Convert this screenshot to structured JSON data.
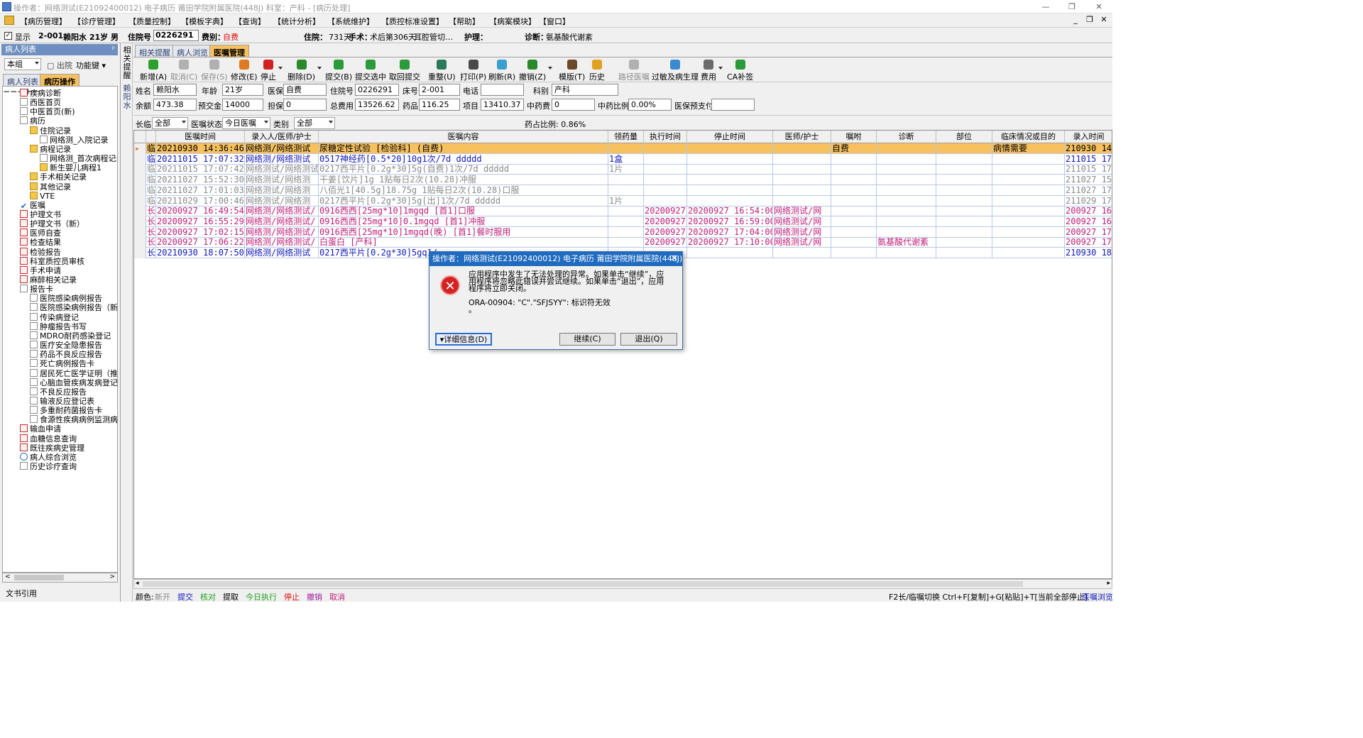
{
  "titlebar": {
    "text": "操作者：网络测试(E21092400012) 电子病历  莆田学院附属医院(448J)  科室：产科 - [病历处理]",
    "min": "—",
    "max": "❐",
    "close": "✕"
  },
  "menu": [
    "【病历管理】",
    "【诊疗管理】",
    "【质量控制】",
    "【模板字典】",
    "【查询】",
    "【统计分析】",
    "【系统维护】",
    "【质控标准设置】",
    "【帮助】",
    "【病案模块】",
    "【窗口】"
  ],
  "menu_right": {
    "min": "_",
    "restore": "❐",
    "close": "✕"
  },
  "patient_bar": {
    "show_label": "显示",
    "bed": "2-001",
    "name_age_sex": "赖阳水 21岁 男",
    "admission_label": "住院号",
    "admission_no": "0226291",
    "fee_label": "费别：",
    "fee_value": "自费",
    "hosp_label": "住院：",
    "hosp_days": "731天",
    "surgery_label": "手术：",
    "surgery_value": "术后第306天",
    "surgery_name": "耳腔管切…",
    "nursing_label": "护理：",
    "diagnosis_label": "诊断：",
    "diagnosis_value": "氨基酸代谢紊"
  },
  "left": {
    "header": "病人列表",
    "pin": "ᵖ",
    "group_value": "本组",
    "discharge_label": "出院",
    "func_label": "功能键",
    "tabs": [
      "病人列表",
      "病历操作"
    ],
    "tree": [
      {
        "label": "疾病诊断",
        "icon": "doc-red-icon"
      },
      {
        "label": "西医首页",
        "icon": "doc-icon"
      },
      {
        "label": "中医首页(新)",
        "icon": "doc-icon"
      },
      {
        "label": "病历",
        "icon": "doc-icon"
      },
      {
        "label": "住院记录",
        "icon": "folder-icon"
      },
      {
        "label": "网络测_入院记录",
        "icon": "doc-icon"
      },
      {
        "label": "病程记录",
        "icon": "folder-icon"
      },
      {
        "label": "网络测_首次病程记录",
        "icon": "doc-icon"
      },
      {
        "label": "新生婴儿病程1",
        "icon": "folder-icon"
      },
      {
        "label": "手术相关记录",
        "icon": "folder-icon"
      },
      {
        "label": "其他记录",
        "icon": "folder-icon"
      },
      {
        "label": "VTE",
        "icon": "folder-icon"
      },
      {
        "label": "医嘱",
        "icon": "check-icon"
      },
      {
        "label": "护理文书",
        "icon": "doc-red-icon"
      },
      {
        "label": "护理文书（新）",
        "icon": "doc-red-icon"
      },
      {
        "label": "医师自查",
        "icon": "doc-red-icon"
      },
      {
        "label": "检查结果",
        "icon": "doc-red-icon"
      },
      {
        "label": "检验报告",
        "icon": "doc-red-icon"
      },
      {
        "label": "科室质控员审核",
        "icon": "doc-red-icon"
      },
      {
        "label": "手术申请",
        "icon": "doc-red-icon"
      },
      {
        "label": "麻醉相关记录",
        "icon": "doc-red-icon"
      },
      {
        "label": "报告卡",
        "icon": "doc-icon"
      },
      {
        "label": "医院感染病例报告",
        "icon": "doc-icon"
      },
      {
        "label": "医院感染病例报告（新）",
        "icon": "doc-icon"
      },
      {
        "label": "传染病登记",
        "icon": "doc-icon"
      },
      {
        "label": "肿瘤报告书写",
        "icon": "doc-icon"
      },
      {
        "label": "MDRO耐药感染登记",
        "icon": "doc-icon"
      },
      {
        "label": "医疗安全隐患报告",
        "icon": "doc-icon"
      },
      {
        "label": "药品不良反应报告",
        "icon": "doc-icon"
      },
      {
        "label": "死亡病例报告卡",
        "icon": "doc-icon"
      },
      {
        "label": "居民死亡医学证明（推断",
        "icon": "doc-icon"
      },
      {
        "label": "心脑血管疾病发病登记报",
        "icon": "doc-icon"
      },
      {
        "label": "不良反应报告",
        "icon": "doc-icon"
      },
      {
        "label": "输液反应登记表",
        "icon": "doc-icon"
      },
      {
        "label": "多重耐药菌报告卡",
        "icon": "doc-icon"
      },
      {
        "label": "食源性疾病病例监测病例",
        "icon": "doc-icon"
      },
      {
        "label": "输血申请",
        "icon": "doc-red-icon"
      },
      {
        "label": "血糖信息查询",
        "icon": "doc-red-icon"
      },
      {
        "label": "既往疾病史管理",
        "icon": "doc-red-icon"
      },
      {
        "label": "病人综合浏览",
        "icon": "search-icon"
      },
      {
        "label": "历史诊疗查询",
        "icon": "doc-icon"
      }
    ],
    "footer": "文书引用"
  },
  "vstrip": {
    "top": "相关提醒",
    "bottom": "赖阳水"
  },
  "tabs": [
    "相关提醒",
    "病人浏览",
    "医嘱管理"
  ],
  "toolbar": [
    {
      "label": "新增(A)",
      "color": "#2aa02a"
    },
    {
      "label": "取消(C)",
      "color": "#b0b0b0",
      "disabled": true
    },
    {
      "label": "保存(S)",
      "color": "#b0b0b0",
      "disabled": true
    },
    {
      "label": "修改(E)",
      "color": "#e07a20"
    },
    {
      "label": "停止",
      "color": "#d02020"
    },
    {
      "label": "删除(D)",
      "color": "#2a8a2a"
    },
    {
      "label": "提交(B)",
      "color": "#2a9a3a"
    },
    {
      "label": "提交选中",
      "color": "#2a9a3a"
    },
    {
      "label": "取回提交",
      "color": "#2a9a3a"
    },
    {
      "label": "重整(U)",
      "color": "#2a7a5a"
    },
    {
      "label": "打印(P)",
      "color": "#4a4a4a"
    },
    {
      "label": "刷新(R)",
      "color": "#3aa0d0"
    },
    {
      "label": "撤销(Z)",
      "color": "#2a8a2a"
    },
    {
      "label": "模版(T)",
      "color": "#6a4a2a"
    },
    {
      "label": "历史",
      "color": "#e0a020"
    },
    {
      "label": "路径医嘱",
      "color": "#b0b0b0",
      "disabled": true
    },
    {
      "label": "过敏及病生理",
      "color": "#3a8ad0"
    },
    {
      "label": "费用",
      "color": "#6a6a6a"
    },
    {
      "label": "CA补签",
      "color": "#2a9a3a"
    }
  ],
  "info": {
    "name_label": "姓名",
    "name": "赖阳水",
    "age_label": "年龄",
    "age": "21岁",
    "insurance_label": "医保",
    "insurance": "自费",
    "inpatient_label": "住院号",
    "inpatient": "0226291",
    "bed_label": "床号",
    "bed": "2-001",
    "phone_label": "电话",
    "phone": "",
    "dept_label": "科别",
    "dept": "产科",
    "balance_label": "余额",
    "balance": "473.38",
    "deposit_label": "预交金",
    "deposit": "14000",
    "guarantee_label": "担保",
    "guarantee": "0",
    "total_label": "总费用",
    "total": "13526.62",
    "drug_label": "药品",
    "drug": "116.25",
    "item_label": "项目",
    "item": "13410.37",
    "tcm_label": "中药费",
    "tcm": "0",
    "tcm_ratio_label": "中药比例",
    "tcm_ratio": "0.00%",
    "prepay_label": "医保预支付",
    "prepay": ""
  },
  "filter": {
    "long_label": "长临",
    "long_value": "全部",
    "status_label": "医嘱状态",
    "status_value": "今日医嘱",
    "type_label": "类别",
    "type_value": "全部",
    "drug_ratio": "药占比例: 0.86%"
  },
  "grid": {
    "columns": [
      "",
      "",
      "医嘱时间",
      "录入人/医师/护士",
      "医嘱内容",
      "领药量",
      "执行时间",
      "停止时间",
      "医师/护士",
      "嘱咐",
      "诊断",
      "部位",
      "临床情况或目的",
      "录入时间"
    ],
    "rows": [
      {
        "style": "sel",
        "cells": [
          "▸",
          "临",
          "20210930 14:36:46",
          "网络测/网络测试",
          "尿糖定性试验  [检验科] (自费)",
          "",
          "",
          "",
          "",
          "自费",
          "",
          "",
          "病情需要",
          "210930 14:36:"
        ]
      },
      {
        "style": "blue",
        "cells": [
          "",
          "临",
          "20211015 17:07:32",
          "网络测/网络测试",
          "0517神经药[0.5*20]10g1次/7d ddddd",
          "1盒",
          "",
          "",
          "",
          "",
          "",
          "",
          "",
          "211015 17:07:"
        ]
      },
      {
        "style": "gray",
        "cells": [
          "",
          "临",
          "20211015 17:07:42",
          "网络测试/网络测试",
          "0217西平片[0.2g*30]5g(自费)1次/7d ddddd",
          "1片",
          "",
          "",
          "",
          "",
          "",
          "",
          "",
          "211015 17:08:"
        ]
      },
      {
        "style": "gray",
        "cells": [
          "",
          "临",
          "20211027 15:52:30",
          "网络测试/网络测",
          "干姜[饮片]1g  1贴每日2次(10.28)冲服",
          "",
          "",
          "",
          "",
          "",
          "",
          "",
          "",
          "211027 15:52:"
        ]
      },
      {
        "style": "gray",
        "cells": [
          "",
          "临",
          "20211027 17:01:03",
          "网络测试/网络测",
          "八佰光1[40.5g]18.75g 1贴每日2次(10.28)口服",
          "",
          "",
          "",
          "",
          "",
          "",
          "",
          "",
          "211027 17:14:"
        ]
      },
      {
        "style": "gray",
        "cells": [
          "",
          "临",
          "20211029 17:00:46",
          "网络测试/网络测",
          "0217西平片[0.2g*30]5g[出]1次/7d ddddd",
          "1片",
          "",
          "",
          "",
          "",
          "",
          "",
          "",
          "211029 17:00:"
        ]
      },
      {
        "style": "pink",
        "cells": [
          "",
          "长",
          "20200927 16:49:54",
          "网络测/网络测试/",
          "0916西西[25mg*10]1mgqd [首1]口服",
          "",
          "20200927",
          "20200927 16:54:00",
          "网络测试/网",
          "",
          "",
          "",
          "",
          "200927 16:44:"
        ]
      },
      {
        "style": "pink",
        "cells": [
          "",
          "长",
          "20200927 16:55:29",
          "网络测/网络测试/",
          "0916西西[25mg*10]0.1mgqd [首1]冲服",
          "",
          "20200927",
          "20200927 16:59:00",
          "网络测试/网",
          "",
          "",
          "",
          "",
          "200927 16:55:"
        ]
      },
      {
        "style": "pink",
        "cells": [
          "",
          "长",
          "20200927 17:02:15",
          "网络测/网络测试/",
          "0916西西[25mg*10]1mgqd(晚) [首1]餐时服用",
          "",
          "20200927",
          "20200927 17:04:00",
          "网络测试/网",
          "",
          "",
          "",
          "",
          "200927 17:02:"
        ]
      },
      {
        "style": "pink",
        "cells": [
          "",
          "长",
          "20200927 17:06:22",
          "网络测/网络测试/",
          "白蛋白  [产科]",
          "",
          "20200927",
          "20200927 17:10:00",
          "网络测试/网",
          "",
          "氨基酸代谢紊",
          "",
          "",
          "200927 17:05:"
        ]
      },
      {
        "style": "blue",
        "cells": [
          "",
          "长",
          "20210930 18:07:50",
          "网络测/网络测试",
          "0217西平片[0.2g*30]5gq1/",
          "",
          "",
          "",
          "",
          "",
          "",
          "",
          "",
          "210930 18:06:"
        ]
      }
    ]
  },
  "statusbar": {
    "colors_label": "颜色:",
    "legend": [
      {
        "label": "新开",
        "color": "#8a8a8a"
      },
      {
        "label": "提交",
        "color": "#1018b8"
      },
      {
        "label": "核对",
        "color": "#20a020"
      },
      {
        "label": "提取",
        "color": "#000000"
      },
      {
        "label": "今日执行",
        "color": "#20a020"
      },
      {
        "label": "停止",
        "color": "#e01010"
      },
      {
        "label": "撤销",
        "color": "#a020a0"
      },
      {
        "label": "取消",
        "color": "#c02078"
      }
    ],
    "shortcut": "F2长/临嘱切换 Ctrl+F[复制]+G[粘贴]+T[当前全部停止]",
    "right_tab": "医嘱浏览"
  },
  "dialog": {
    "title": "操作者：网络测试(E21092400012) 电子病历  莆田学院附属医院(448J)  ...",
    "close": "✕",
    "message": "应用程序中发生了无法处理的异常。如果单击“继续”，应用程序将忽略此错误并尝试继续。如果单击“退出”，应用程序将立即关闭。",
    "error_detail": "ORA-00904: \"C\".\"SFJSYY\": 标识符无效\n。",
    "details_button": "▾详细信息(D)",
    "continue_button": "继续(C)",
    "exit_button": "退出(Q)"
  }
}
